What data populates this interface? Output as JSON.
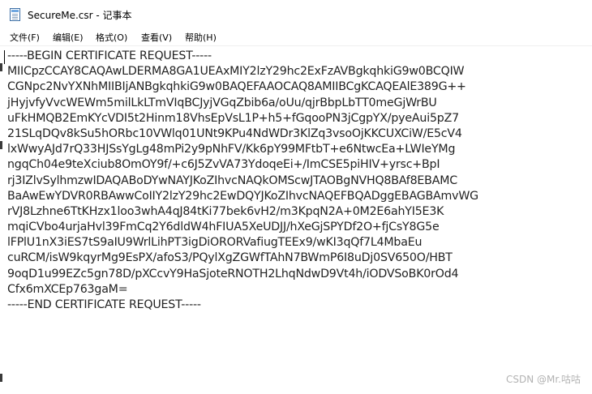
{
  "window": {
    "title": "SecureMe.csr - 记事本"
  },
  "menu": {
    "file": "文件(F)",
    "edit": "编辑(E)",
    "format": "格式(O)",
    "view": "查看(V)",
    "help": "帮助(H)"
  },
  "document": {
    "lines": [
      "-----BEGIN CERTIFICATE REQUEST-----",
      "MIICpzCCAY8CAQAwLDERMA8GA1UEAxMIY2lzY29hc2ExFzAVBgkqhkiG9w0BCQIW",
      "CGNpc2NvYXNhMIIBIjANBgkqhkiG9w0BAQEFAAOCAQ8AMIIBCgKCAQEAlE389G++",
      "jHyjvfyVvcWEWm5milLkLTmVIqBCJyjVGqZbib6a/oUu/qjrBbpLbTT0meGjWrBU",
      "uFkHMQB2EmKYcVDI5t2Hinm18VhsEpVsL1P+h5+fGqooPN3jCgpYX/pyeAui5pZ7",
      "21SLqDQv8kSu5hORbc10VWlq01UNt9KPu4NdWDr3KlZq3vsoOjKKCUXCiW/E5cV4",
      "lxWwyAJd7rQ33HJSsYgLg48mPi2y9pNhFV/Kk6pY99MFtbT+e6NtwcEa+LWIeYMg",
      "ngqCh04e9teXciub8OmOY9f/+c6J5ZvVA73YdoqeEi+/ImCSE5piHIV+yrsc+BpI",
      "rj3IZlvSylhmzwIDAQABoDYwNAYJKoZIhvcNAQkOMScwJTAOBgNVHQ8BAf8EBAMC",
      "BaAwEwYDVR0RBAwwCoIIY2lzY29hc2EwDQYJKoZIhvcNAQEFBQADggEBAGBAmvWG",
      "rVJ8Lzhne6TtKHzx1loo3whA4qJ84tKi77bek6vH2/m3KpqN2A+0M2E6ahYI5E3K",
      "mqiCVbo4urjaHvl39FmCq2Y6dldW4hFIUA5XeUDJJ/hXeGjSPYDf2O+fjCsY8G5e",
      "lFPlU1nX3iES7tS9aIU9WrlLihPT3igDiORORVafiugTEEx9/wKI3qQf7L4MbaEu",
      "cuRCM/isW9kqyrMg9EsPX/afoS3/PQylXgZGWfTAhN7BWmP6I8uDj0SV650O/HBT",
      "9oqD1u99EZc5gn78D/pXCcvY9HaSjoteRNOTH2LhqNdwD9Vt4h/iODVSoBK0rOd4",
      "Cfx6mXCEp763gaM=",
      "-----END CERTIFICATE REQUEST-----"
    ]
  },
  "watermark": "CSDN @Mr.咕咕",
  "icons": {
    "app": "notepad-icon"
  },
  "colors": {
    "text": "#222222",
    "watermark": "#b3b3b3"
  }
}
